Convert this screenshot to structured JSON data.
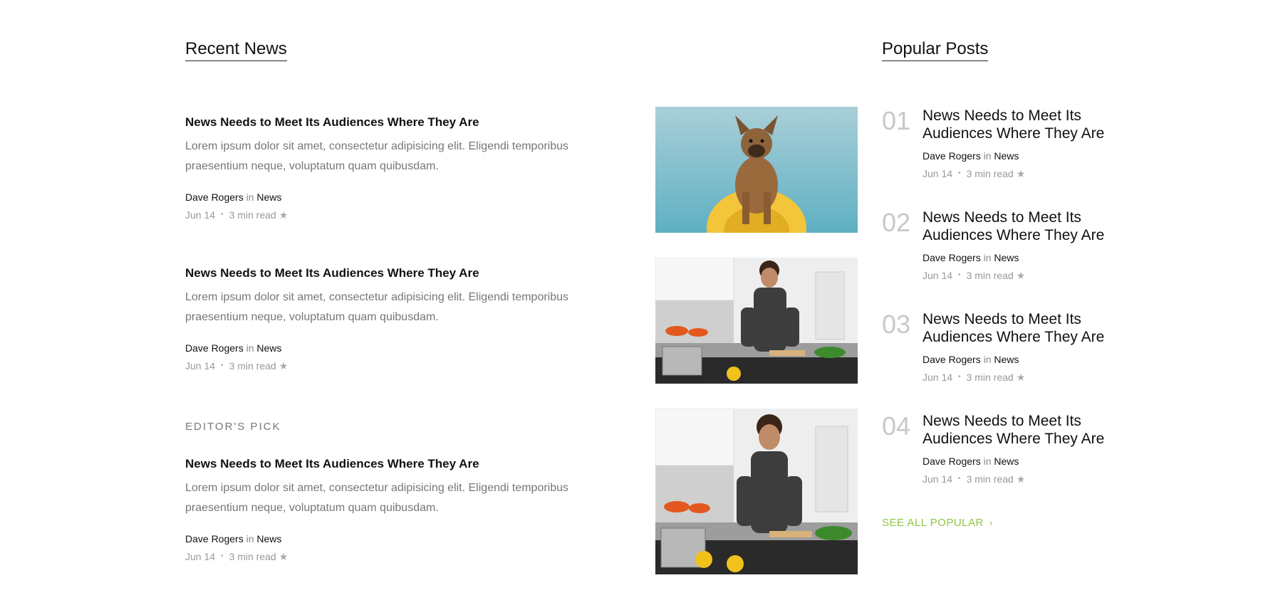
{
  "recent": {
    "title": "Recent News",
    "items": [
      {
        "headline": "News Needs to Meet Its Audiences Where They Are",
        "excerpt": "Lorem ipsum dolor sit amet, consectetur adipisicing elit. Eligendi temporibus praesentium neque, voluptatum quam quibusdam.",
        "author": "Dave Rogers",
        "in": "in",
        "category": "News",
        "date": "Jun 14",
        "dot": "•",
        "read": "3 min read",
        "star": "★",
        "image": "dog-on-kayak"
      },
      {
        "headline": "News Needs to Meet Its Audiences Where They Are",
        "excerpt": "Lorem ipsum dolor sit amet, consectetur adipisicing elit. Eligendi temporibus praesentium neque, voluptatum quam quibusdam.",
        "author": "Dave Rogers",
        "in": "in",
        "category": "News",
        "date": "Jun 14",
        "dot": "•",
        "read": "3 min read",
        "star": "★",
        "image": "man-cooking-kitchen"
      }
    ],
    "editors_pick": {
      "eyebrow": "EDITOR'S PICK",
      "headline": "News Needs to Meet Its Audiences Where They Are",
      "excerpt": "Lorem ipsum dolor sit amet, consectetur adipisicing elit. Eligendi temporibus praesentium neque, voluptatum quam quibusdam.",
      "author": "Dave Rogers",
      "in": "in",
      "category": "News",
      "date": "Jun 14",
      "dot": "•",
      "read": "3 min read",
      "star": "★",
      "image": "man-cooking-kitchen"
    }
  },
  "popular": {
    "title": "Popular Posts",
    "items": [
      {
        "num": "01",
        "title": "News Needs to Meet Its Audiences Where They Are",
        "author": "Dave Rogers",
        "in": "in",
        "category": "News",
        "date": "Jun 14",
        "dot": "•",
        "read": "3 min read",
        "star": "★"
      },
      {
        "num": "02",
        "title": "News Needs to Meet Its Audiences Where They Are",
        "author": "Dave Rogers",
        "in": "in",
        "category": "News",
        "date": "Jun 14",
        "dot": "•",
        "read": "3 min read",
        "star": "★"
      },
      {
        "num": "03",
        "title": "News Needs to Meet Its Audiences Where They Are",
        "author": "Dave Rogers",
        "in": "in",
        "category": "News",
        "date": "Jun 14",
        "dot": "•",
        "read": "3 min read",
        "star": "★"
      },
      {
        "num": "04",
        "title": "News Needs to Meet Its Audiences Where They Are",
        "author": "Dave Rogers",
        "in": "in",
        "category": "News",
        "date": "Jun 14",
        "dot": "•",
        "read": "3 min read",
        "star": "★"
      }
    ],
    "see_all": "SEE ALL POPULAR",
    "see_all_icon": "chevron-right-icon",
    "chev": "›"
  },
  "colors": {
    "accent": "#8dc63f",
    "muted": "#777777",
    "number": "#c8c8c8"
  }
}
